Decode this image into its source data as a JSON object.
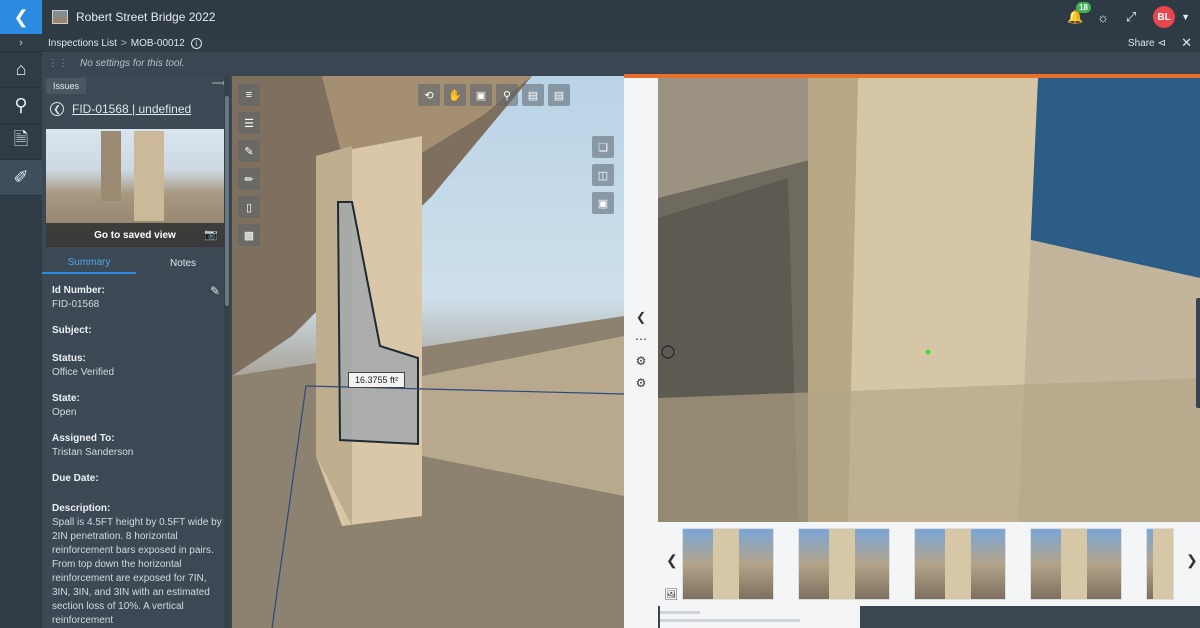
{
  "app": {
    "project_title": "Robert Street Bridge 2022",
    "notification_count": "18",
    "avatar_initials": "BL",
    "accent": "#2b8be0"
  },
  "breadcrumb": {
    "root": "Inspections List",
    "separator": ">",
    "current": "MOB-00012"
  },
  "header_actions": {
    "share_label": "Share"
  },
  "tool_settings": {
    "message": "No settings for this tool."
  },
  "issue_panel": {
    "tab_label": "Issues",
    "issue_title": "FID-01568 | undefined",
    "saved_view_label": "Go to saved view",
    "tabs": [
      "Summary",
      "Notes"
    ],
    "active_tab": "Summary",
    "fields": [
      {
        "label": "Id Number:",
        "value": "FID-01568"
      },
      {
        "label": "Subject:",
        "value": ""
      },
      {
        "label": "Status:",
        "value": "Office Verified"
      },
      {
        "label": "State:",
        "value": "Open"
      },
      {
        "label": "Assigned To:",
        "value": "Tristan Sanderson"
      },
      {
        "label": "Due Date:",
        "value": ""
      },
      {
        "label": "Description:",
        "value": "Spall is 4.5FT height by 0.5FT wide by 2IN penetration. 8 horizontal reinforcement bars exposed in pairs. From top down the horizontal reinforcement are exposed for 7IN, 3IN, 3IN, and 3IN with an estimated section loss of 10%. A vertical reinforcement"
      }
    ]
  },
  "viewer": {
    "measurement": "16.3755 ft²"
  }
}
